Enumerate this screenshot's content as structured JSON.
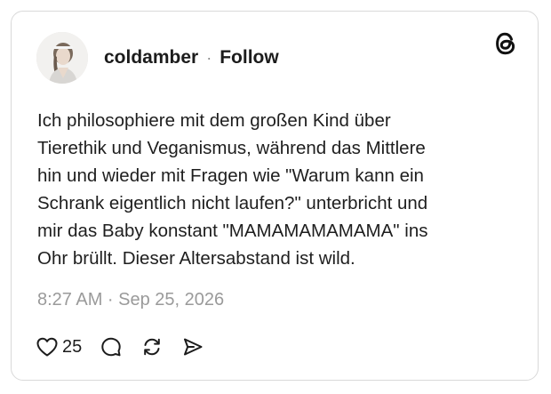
{
  "post": {
    "author": {
      "username": "coldamber",
      "separator": "·",
      "follow_label": "Follow",
      "avatar_icon": "user-avatar-photo"
    },
    "logo_icon": "threads-logo-icon",
    "text": "Ich philosophiere mit dem großen Kind über\nTierethik und Veganismus, während das Mittlere\nhin und wieder mit Fragen wie \"Warum kann ein\nSchrank eigentlich nicht laufen?\" unterbricht und\nmir das Baby konstant \"MAMAMAMAMAMA\" ins\nOhr brüllt. Dieser Altersabstand ist wild.",
    "timestamp": "8:27 AM · Sep 25, 2026",
    "actions": {
      "like_icon": "heart-icon",
      "like_count": "25",
      "reply_icon": "comment-icon",
      "repost_icon": "repost-icon",
      "share_icon": "send-icon"
    }
  },
  "colors": {
    "text": "#1e1e1e",
    "muted": "#9a9a9a",
    "border": "#d9d9d9"
  }
}
